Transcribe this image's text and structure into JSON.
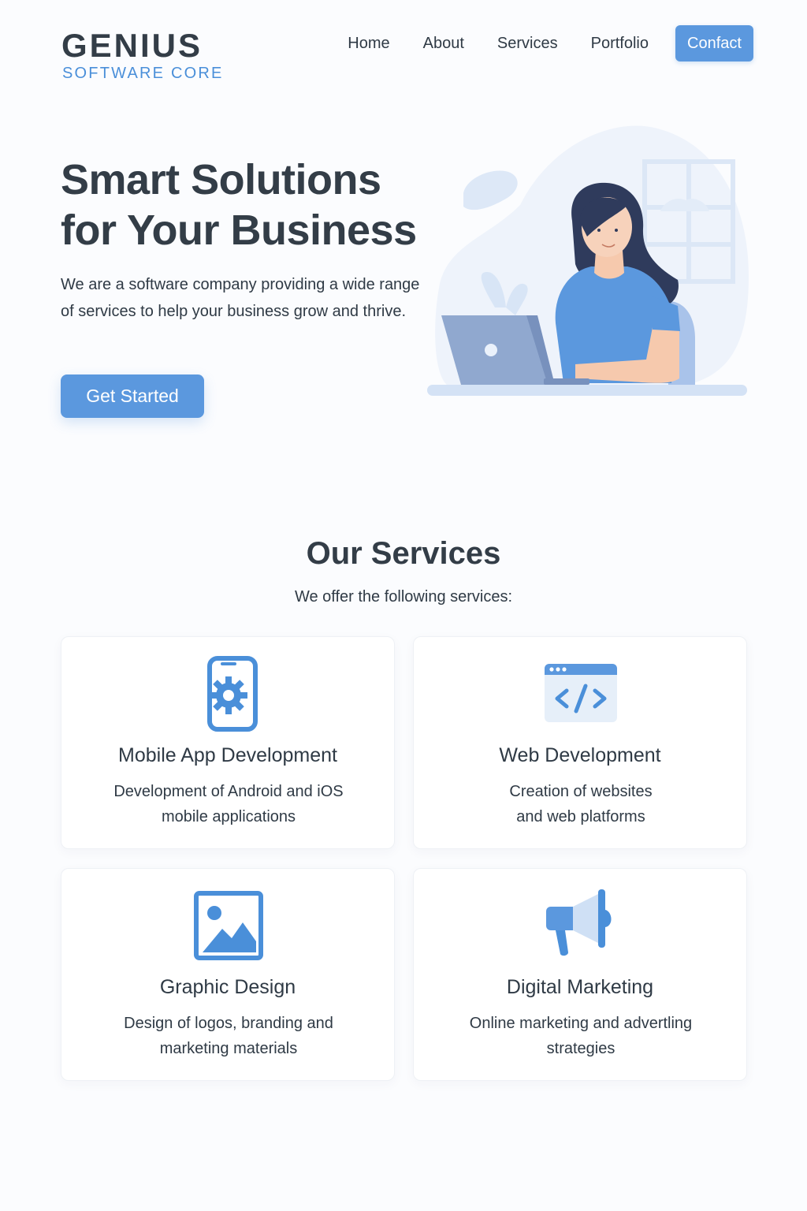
{
  "brand": {
    "name": "GENIUS",
    "tagline": "SOFTWARE CORE"
  },
  "nav": {
    "items": [
      "Home",
      "About",
      "Services",
      "Portfolio"
    ],
    "cta": "Confact"
  },
  "hero": {
    "title_line1": "Smart Solutions",
    "title_line2": "for Your Business",
    "text": "We are a software company providing a wide range of services to help your business grow and thrive.",
    "button": "Get Started",
    "illustration": "woman-working-on-laptop"
  },
  "services": {
    "title": "Our Services",
    "subtitle": "We offer the following services:",
    "items": [
      {
        "icon": "mobile-gear-icon",
        "title": "Mobile App Development",
        "desc_line1": "Development of Android and iOS",
        "desc_line2": "mobile applications"
      },
      {
        "icon": "code-window-icon",
        "title": "Web Development",
        "desc_line1": "Creation of websites",
        "desc_line2": "and web platforms"
      },
      {
        "icon": "image-icon",
        "title": "Graphic Design",
        "desc_line1": "Design of logos, branding and",
        "desc_line2": "marketing materials"
      },
      {
        "icon": "megaphone-icon",
        "title": "Digital Marketing",
        "desc_line1": "Online marketing and advertling",
        "desc_line2": "strategies"
      }
    ]
  },
  "colors": {
    "accent": "#5b98de",
    "text": "#333d47",
    "background": "#fbfcfe"
  }
}
